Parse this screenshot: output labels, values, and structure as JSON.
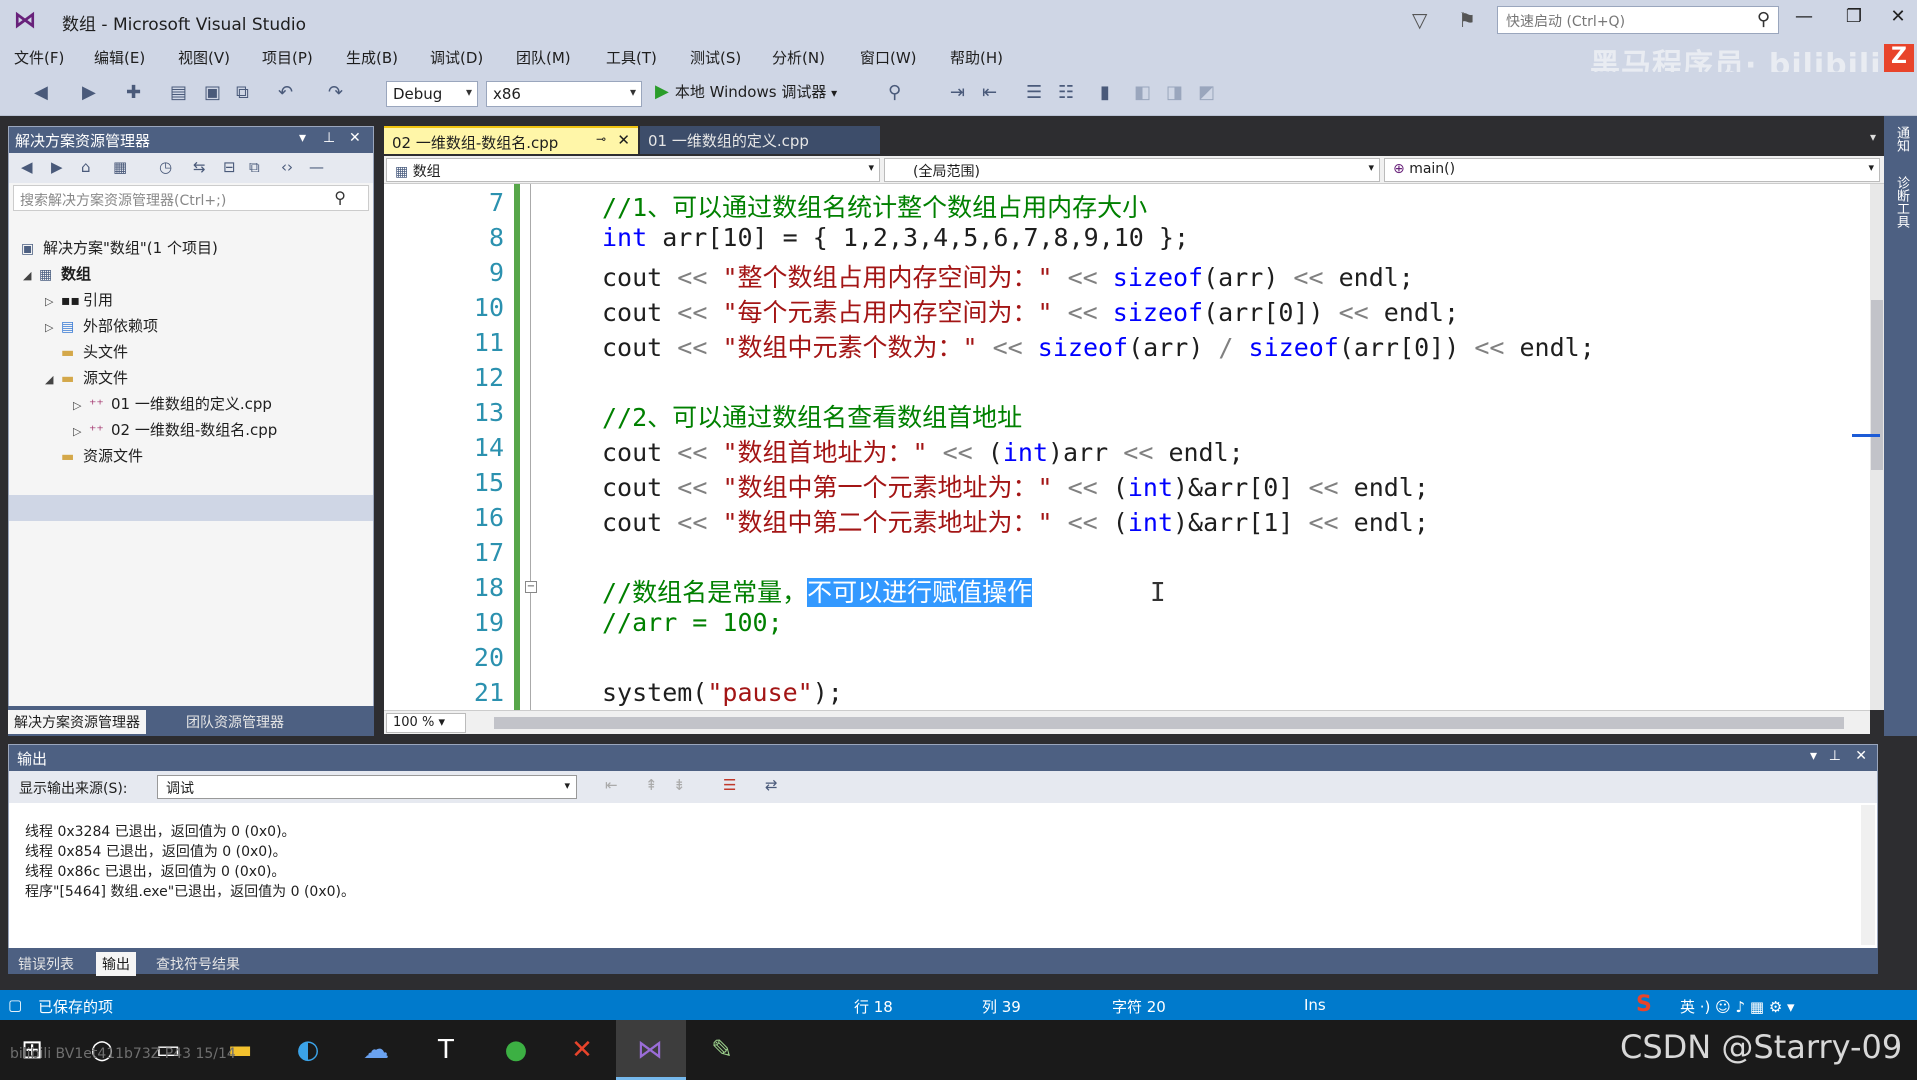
{
  "window": {
    "title": "数组 - Microsoft Visual Studio",
    "quick_launch_placeholder": "快速启动 (Ctrl+Q)",
    "brand_color": "#68217a"
  },
  "menu": [
    "文件(F)",
    "编辑(E)",
    "视图(V)",
    "项目(P)",
    "生成(B)",
    "调试(D)",
    "团队(M)",
    "工具(T)",
    "测试(S)",
    "分析(N)",
    "窗口(W)",
    "帮助(H)"
  ],
  "toolbar": {
    "config": "Debug",
    "platform": "x86",
    "run_label": "本地 Windows 调试器"
  },
  "solution_explorer": {
    "title": "解决方案资源管理器",
    "search_placeholder": "搜索解决方案资源管理器(Ctrl+;)",
    "tree": [
      {
        "label": "解决方案\"数组\"(1 个项目)",
        "level": 0,
        "expander": ""
      },
      {
        "label": "数组",
        "level": 1,
        "expander": "◢"
      },
      {
        "label": "引用",
        "level": 2,
        "expander": "▷"
      },
      {
        "label": "外部依赖项",
        "level": 2,
        "expander": "▷"
      },
      {
        "label": "头文件",
        "level": 2,
        "expander": ""
      },
      {
        "label": "源文件",
        "level": 2,
        "expander": "◢"
      },
      {
        "label": "01 一维数组的定义.cpp",
        "level": 3,
        "expander": "▷"
      },
      {
        "label": "02 一维数组-数组名.cpp",
        "level": 3,
        "expander": "▷"
      },
      {
        "label": "资源文件",
        "level": 2,
        "expander": ""
      }
    ],
    "tabs": [
      "解决方案资源管理器",
      "团队资源管理器"
    ]
  },
  "editor": {
    "tabs": [
      {
        "label": "02 一维数组-数组名.cpp",
        "active": true
      },
      {
        "label": "01 一维数组的定义.cpp",
        "active": false
      }
    ],
    "nav": {
      "project": "数组",
      "scope": "(全局范围)",
      "member": "main()"
    },
    "zoom": "100 %",
    "line_numbers": [
      "7",
      "8",
      "9",
      "10",
      "11",
      "12",
      "13",
      "14",
      "15",
      "16",
      "17",
      "18",
      "19",
      "20",
      "21"
    ],
    "lines": {
      "l7": "//1、可以通过数组名统计整个数组占用内存大小",
      "l8_kw": "int",
      "l8_rest": " arr[10] = { 1,2,3,4,5,6,7,8,9,10 };",
      "cout": "cout",
      "endl": "endl;",
      "sizeof": "sizeof",
      "l9_str": "\"整个数组占用内存空间为：\"",
      "l10_str": "\"每个元素占用内存空间为：\"",
      "l11_str": "\"数组中元素个数为：\"",
      "l13": "//2、可以通过数组名查看数组首地址",
      "l14_str": "\"数组首地址为：\"",
      "l15_str": "\"数组中第一个元素地址为：\"",
      "l16_str": "\"数组中第二个元素地址为：\"",
      "int_kw": "int",
      "l18_a": "//数组名是常量，",
      "l18_sel": "不可以进行赋值操作",
      "l19": "//arr = 100;",
      "l21_fn": "system(",
      "l21_str": "\"pause\"",
      "l21_end": ");"
    }
  },
  "output": {
    "title": "输出",
    "source_label": "显示输出来源(S):",
    "source_value": "调试",
    "lines": [
      "线程 0x3284 已退出，返回值为 0 (0x0)。",
      "线程 0x854 已退出，返回值为 0 (0x0)。",
      "线程 0x86c 已退出，返回值为 0 (0x0)。",
      "程序\"[5464] 数组.exe\"已退出，返回值为 0 (0x0)。"
    ],
    "tabs": [
      "错误列表",
      "输出",
      "查找符号结果"
    ]
  },
  "right_strip": [
    "通知",
    "诊断工具"
  ],
  "statusbar": {
    "saved": "已保存的项",
    "row": "行 18",
    "col": "列 39",
    "char": "字符 20",
    "mode": "Ins"
  },
  "watermarks": {
    "top": "黑马程序员· bilibili",
    "csdn": "CSDN @Starry-09",
    "bottom_left": "bilibili BV1et411b73Z P43 15/14"
  }
}
